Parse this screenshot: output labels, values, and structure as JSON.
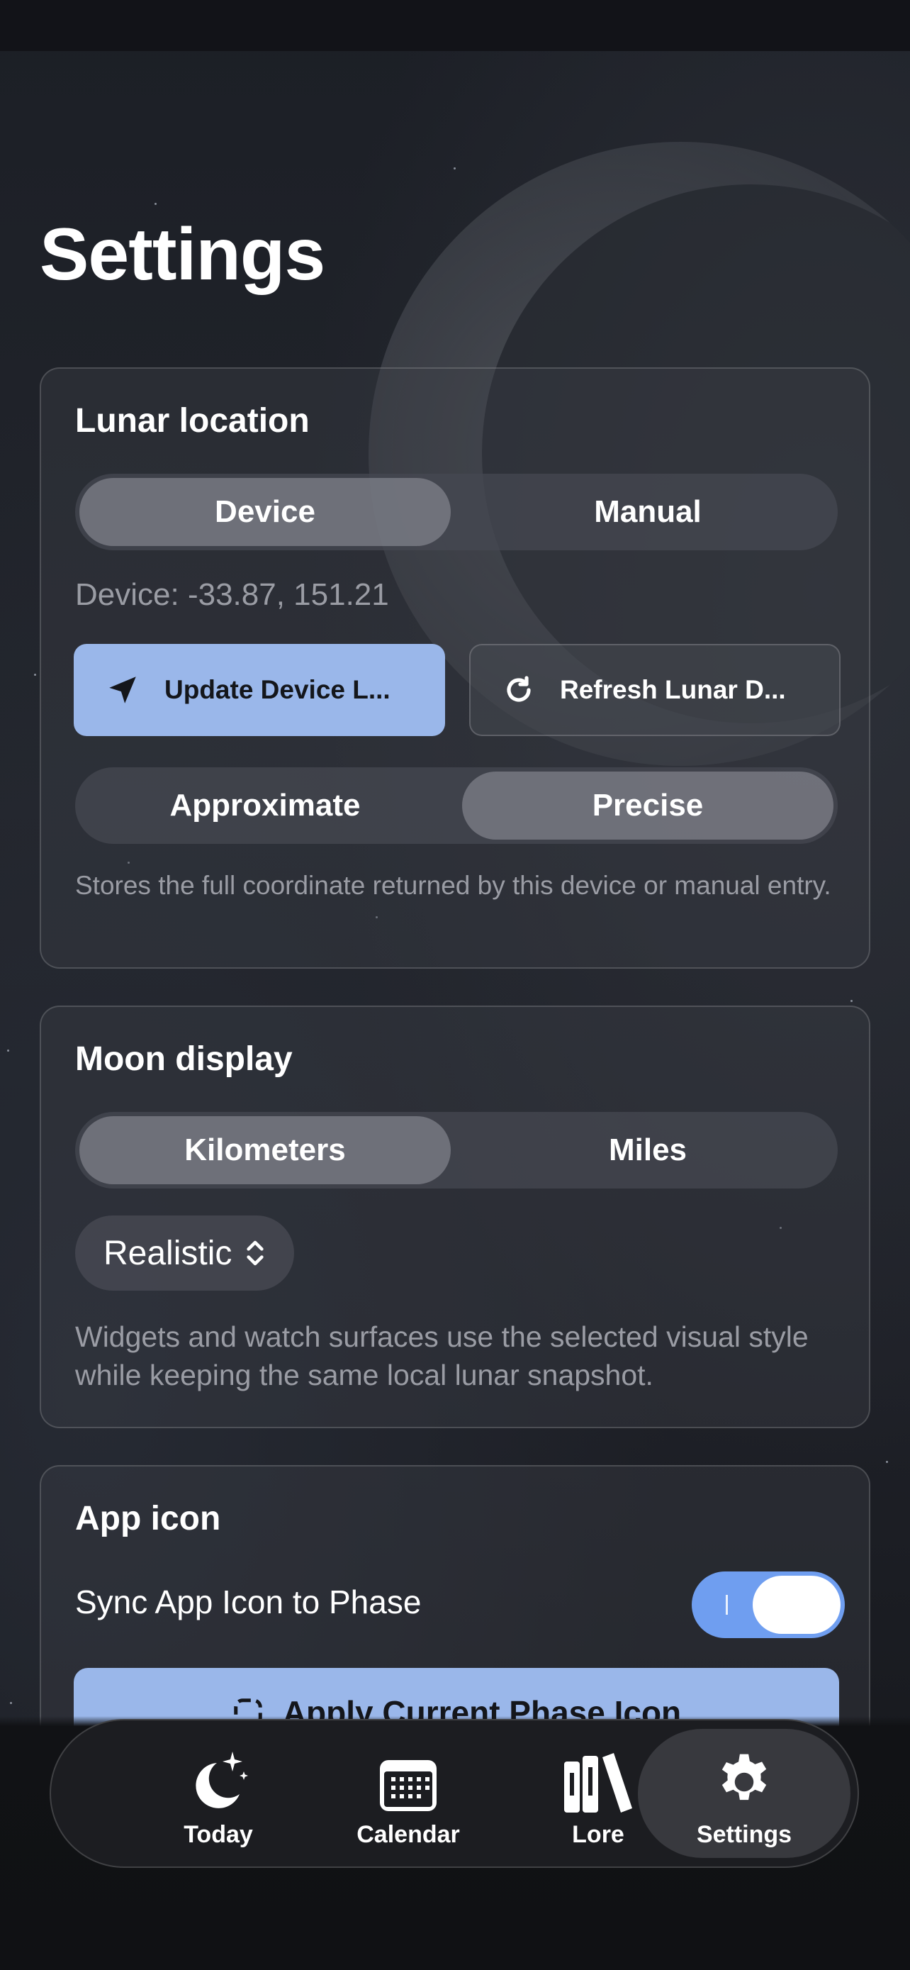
{
  "page": {
    "title": "Settings"
  },
  "lunar_location": {
    "title": "Lunar location",
    "source_options": [
      "Device",
      "Manual"
    ],
    "source_selected": "Device",
    "device_coords": "Device: -33.87, 151.21",
    "update_button": "Update Device L...",
    "refresh_button": "Refresh Lunar D...",
    "precision_options": [
      "Approximate",
      "Precise"
    ],
    "precision_selected": "Precise",
    "note": "Stores the full coordinate returned by this device or manual entry."
  },
  "moon_display": {
    "title": "Moon display",
    "unit_options": [
      "Kilometers",
      "Miles"
    ],
    "unit_selected": "Kilometers",
    "style_value": "Realistic",
    "note": "Widgets and watch surfaces use the selected visual style while keeping the same local lunar snapshot."
  },
  "app_icon": {
    "title": "App icon",
    "sync_label": "Sync App Icon to Phase",
    "sync_enabled": true,
    "apply_button": "Apply Current Phase Icon"
  },
  "tabbar": {
    "items": [
      {
        "label": "Today",
        "icon": "moon-stars-icon"
      },
      {
        "label": "Calendar",
        "icon": "calendar-icon"
      },
      {
        "label": "Lore",
        "icon": "books-icon"
      },
      {
        "label": "Settings",
        "icon": "gear-icon"
      }
    ],
    "active": "Settings"
  },
  "colors": {
    "accent": "#9ab7ea",
    "toggle_on": "#6f9ef0",
    "background": "#1e2027"
  }
}
